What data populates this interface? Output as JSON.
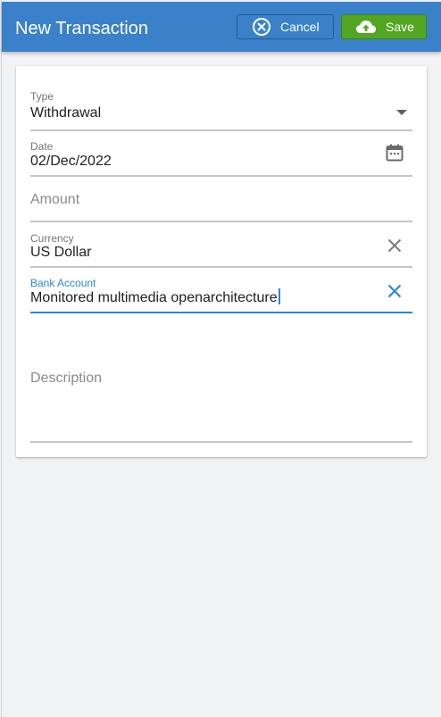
{
  "header": {
    "title": "New Transaction",
    "cancel_label": "Cancel",
    "save_label": "Save"
  },
  "form": {
    "type": {
      "label": "Type",
      "value": "Withdrawal"
    },
    "date": {
      "label": "Date",
      "value": "02/Dec/2022"
    },
    "amount": {
      "placeholder": "Amount",
      "value": ""
    },
    "currency": {
      "label": "Currency",
      "value": "US Dollar"
    },
    "bank_account": {
      "label": "Bank Account",
      "value": "Monitored multimedia openarchitecture"
    },
    "description": {
      "placeholder": "Description",
      "value": ""
    }
  },
  "colors": {
    "appbar": "#3a81c9",
    "save_button": "#52a621",
    "focus": "#2a86d8"
  },
  "icons": {
    "cancel": "close-circle-icon",
    "save": "cloud-upload-icon",
    "type_dropdown": "dropdown-arrow-icon",
    "date": "calendar-icon",
    "currency_clear": "clear-icon",
    "bank_clear": "clear-icon"
  }
}
